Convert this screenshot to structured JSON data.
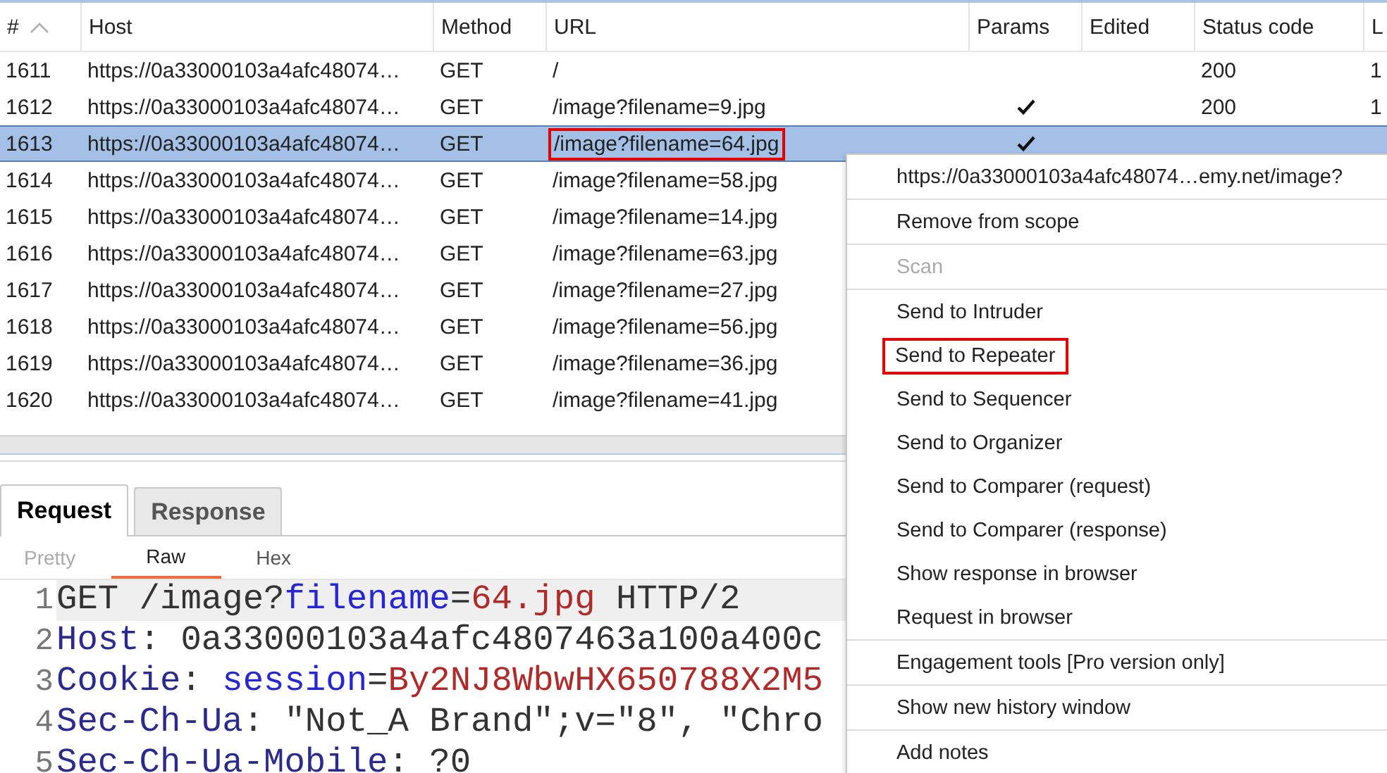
{
  "table": {
    "columns": [
      "#",
      "Host",
      "Method",
      "URL",
      "Params",
      "Edited",
      "Status code",
      "L"
    ],
    "rows": [
      {
        "num": "1611",
        "host": "https://0a33000103a4afc48074…",
        "method": "GET",
        "url": "/",
        "params": false,
        "status": "200",
        "length": "1",
        "selected": false,
        "url_highlighted": false
      },
      {
        "num": "1612",
        "host": "https://0a33000103a4afc48074…",
        "method": "GET",
        "url": "/image?filename=9.jpg",
        "params": true,
        "status": "200",
        "length": "1",
        "selected": false,
        "url_highlighted": false
      },
      {
        "num": "1613",
        "host": "https://0a33000103a4afc48074…",
        "method": "GET",
        "url": "/image?filename=64.jpg",
        "params": true,
        "selected": true,
        "url_highlighted": true
      },
      {
        "num": "1614",
        "host": "https://0a33000103a4afc48074…",
        "method": "GET",
        "url": "/image?filename=58.jpg",
        "selected": false,
        "url_highlighted": false
      },
      {
        "num": "1615",
        "host": "https://0a33000103a4afc48074…",
        "method": "GET",
        "url": "/image?filename=14.jpg",
        "selected": false,
        "url_highlighted": false
      },
      {
        "num": "1616",
        "host": "https://0a33000103a4afc48074…",
        "method": "GET",
        "url": "/image?filename=63.jpg",
        "selected": false,
        "url_highlighted": false
      },
      {
        "num": "1617",
        "host": "https://0a33000103a4afc48074…",
        "method": "GET",
        "url": "/image?filename=27.jpg",
        "selected": false,
        "url_highlighted": false
      },
      {
        "num": "1618",
        "host": "https://0a33000103a4afc48074…",
        "method": "GET",
        "url": "/image?filename=56.jpg",
        "selected": false,
        "url_highlighted": false
      },
      {
        "num": "1619",
        "host": "https://0a33000103a4afc48074…",
        "method": "GET",
        "url": "/image?filename=36.jpg",
        "selected": false,
        "url_highlighted": false
      },
      {
        "num": "1620",
        "host": "https://0a33000103a4afc48074…",
        "method": "GET",
        "url": "/image?filename=41.jpg",
        "selected": false,
        "url_highlighted": false
      }
    ]
  },
  "tabs": [
    {
      "label": "Request",
      "selected": true
    },
    {
      "label": "Response",
      "selected": false
    }
  ],
  "subtabs": [
    {
      "label": "Pretty",
      "selected": false
    },
    {
      "label": "Raw",
      "selected": true
    },
    {
      "label": "Hex",
      "selected": false
    }
  ],
  "editor": {
    "lines": [
      {
        "number": "1",
        "current": true,
        "tokens": [
          {
            "kind": "plain",
            "text": "GET /image?"
          },
          {
            "kind": "param",
            "text": "filename"
          },
          {
            "kind": "plain",
            "text": "="
          },
          {
            "kind": "value",
            "text": "64.jpg"
          },
          {
            "kind": "plain",
            "text": " HTTP/2"
          }
        ]
      },
      {
        "number": "2",
        "current": false,
        "tokens": [
          {
            "kind": "key",
            "text": "Host"
          },
          {
            "kind": "plain",
            "text": ": 0a33000103a4afc4807463a100a400c"
          }
        ]
      },
      {
        "number": "3",
        "current": false,
        "tokens": [
          {
            "kind": "key",
            "text": "Cookie"
          },
          {
            "kind": "plain",
            "text": ": "
          },
          {
            "kind": "param",
            "text": "session"
          },
          {
            "kind": "plain",
            "text": "="
          },
          {
            "kind": "value",
            "text": "By2NJ8WbwHX650788X2M5"
          }
        ]
      },
      {
        "number": "4",
        "current": false,
        "tokens": [
          {
            "kind": "key",
            "text": "Sec-Ch-Ua"
          },
          {
            "kind": "plain",
            "text": ": \"Not_A Brand\";v=\"8\", \"Chro"
          }
        ]
      },
      {
        "number": "5",
        "current": false,
        "tokens": [
          {
            "kind": "key",
            "text": "Sec-Ch-Ua-Mobile"
          },
          {
            "kind": "plain",
            "text": ": ?0"
          }
        ]
      }
    ]
  },
  "context_menu": {
    "groups": [
      [
        {
          "label": "https://0a33000103a4afc48074…emy.net/image?",
          "disabled": false,
          "highlighted": false
        }
      ],
      [
        {
          "label": "Remove from scope",
          "disabled": false,
          "highlighted": false
        }
      ],
      [
        {
          "label": "Scan",
          "disabled": true,
          "highlighted": false
        }
      ],
      [
        {
          "label": "Send to Intruder",
          "disabled": false,
          "highlighted": false
        },
        {
          "label": "Send to Repeater",
          "disabled": false,
          "highlighted": true
        },
        {
          "label": "Send to Sequencer",
          "disabled": false,
          "highlighted": false
        },
        {
          "label": "Send to Organizer",
          "disabled": false,
          "highlighted": false
        },
        {
          "label": "Send to Comparer (request)",
          "disabled": false,
          "highlighted": false
        },
        {
          "label": "Send to Comparer (response)",
          "disabled": false,
          "highlighted": false
        },
        {
          "label": "Show response in browser",
          "disabled": false,
          "highlighted": false
        },
        {
          "label": "Request in browser",
          "disabled": false,
          "highlighted": false
        }
      ],
      [
        {
          "label": "Engagement tools [Pro version only]",
          "disabled": false,
          "highlighted": false
        }
      ],
      [
        {
          "label": "Show new history window",
          "disabled": false,
          "highlighted": false
        }
      ],
      [
        {
          "label": "Add notes",
          "disabled": false,
          "highlighted": false
        }
      ]
    ]
  }
}
